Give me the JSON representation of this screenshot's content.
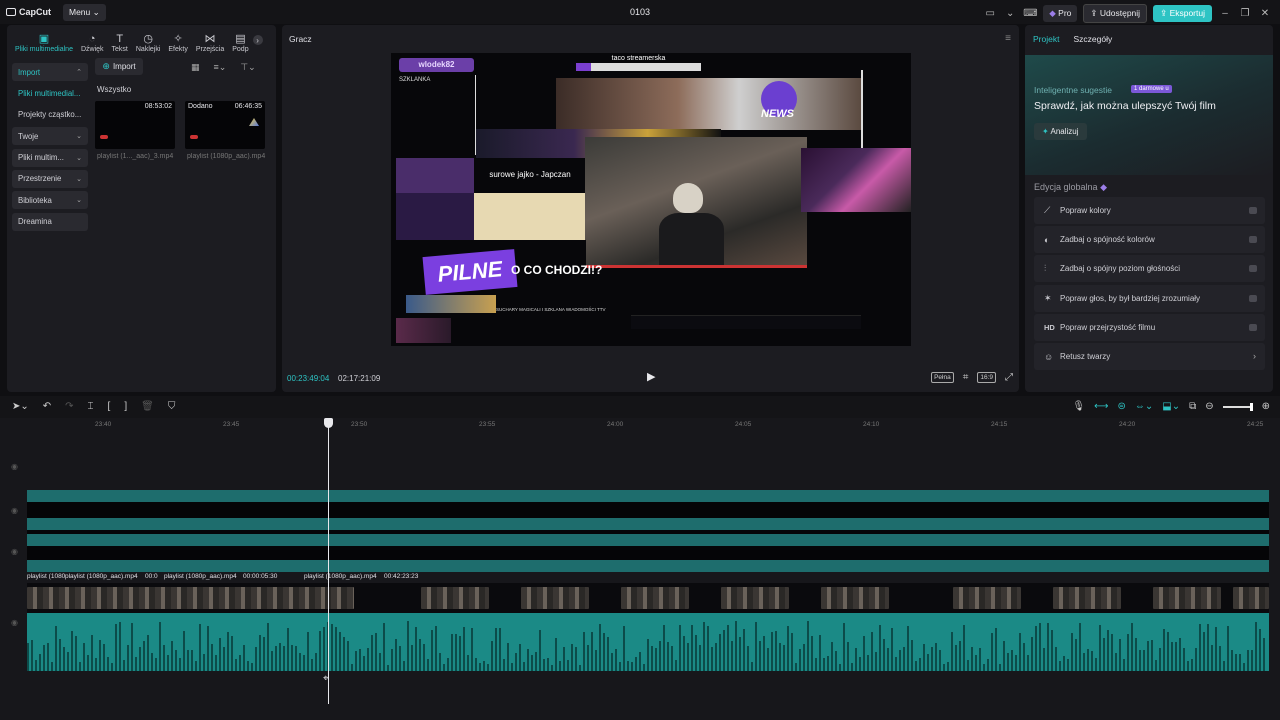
{
  "app": {
    "logo_text": "CapCut",
    "menu_label": "Menu",
    "project_title": "0103",
    "pro_label": "Pro",
    "share_label": "Udostępnij",
    "export_label": "Eksportuj"
  },
  "tools": [
    {
      "label": "Pliki multimedialne",
      "icon": "media-icon"
    },
    {
      "label": "Dźwięk",
      "icon": "audio-icon"
    },
    {
      "label": "Tekst",
      "icon": "text-icon"
    },
    {
      "label": "Naklejki",
      "icon": "sticker-icon"
    },
    {
      "label": "Efekty",
      "icon": "effects-icon"
    },
    {
      "label": "Przejścia",
      "icon": "transitions-icon"
    },
    {
      "label": "Podp",
      "icon": "captions-icon"
    }
  ],
  "sidenav": [
    {
      "label": "Import"
    },
    {
      "label": "Pliki multimedial..."
    },
    {
      "label": "Projekty cząstko..."
    },
    {
      "label": "Twoje"
    },
    {
      "label": "Pliki multim..."
    },
    {
      "label": "Przestrzenie"
    },
    {
      "label": "Biblioteka"
    },
    {
      "label": "Dreamina"
    }
  ],
  "media": {
    "import_label": "Import",
    "all_label": "Wszystko",
    "items": [
      {
        "duration": "08:53:02",
        "added": "",
        "name": "playlist (1..._aac)_3.mp4"
      },
      {
        "duration": "06:46:35",
        "added": "Dodano",
        "name": "playlist (1080p_aac).mp4"
      }
    ]
  },
  "player": {
    "title": "Gracz",
    "current_time": "00:23:49:04",
    "total_time": "02:17:21:09",
    "quality_label": "Pełna",
    "ratio_label": "16:9",
    "video": {
      "top_title": "taco streamerska",
      "channel_name": "wlodek82",
      "side_label": "SZKLANKA",
      "news_label": "NEWS",
      "caption": "surowe jajko - Japczan",
      "urgent": "PILNE",
      "headline": "O CO CHODZI!?",
      "ticker": "SUCHARY MAGICALI I SZKLANA WIADOMOŚCI TTV"
    }
  },
  "right_panel": {
    "tab_project": "Projekt",
    "tab_details": "Szczegóły",
    "smart_label": "Inteligentne sugestie",
    "free_badge": "1 darmowe u",
    "smart_title": "Sprawdź, jak można ulepszyć Twój film",
    "analyze_label": "Analizuj",
    "global_title": "Edycja globalna",
    "features": [
      {
        "label": "Popraw kolory",
        "icon": "wand-icon"
      },
      {
        "label": "Zadbaj o spójność kolorów",
        "icon": "color-match-icon"
      },
      {
        "label": "Zadbaj o spójny poziom głośności",
        "icon": "volume-sliders-icon"
      },
      {
        "label": "Popraw głos, by był bardziej zrozumiały",
        "icon": "voice-enhance-icon"
      },
      {
        "label": "Popraw przejrzystość filmu",
        "icon": "hd-icon"
      },
      {
        "label": "Retusz twarzy",
        "icon": "face-retouch-icon"
      }
    ]
  },
  "timeline": {
    "ruler_labels": [
      "23:40",
      "23:45",
      "23:50",
      "23:55",
      "24:00",
      "24:05",
      "24:10",
      "24:15",
      "24:20",
      "24:25"
    ],
    "clip_labels": [
      "playlist (1080",
      "playlist (1080p_aac).mp4",
      "00:0",
      "playlist (1080p_aac).mp4",
      "00:00:05:30",
      "playlist (1080p_aac).mp4",
      "00:42:23:23"
    ]
  }
}
